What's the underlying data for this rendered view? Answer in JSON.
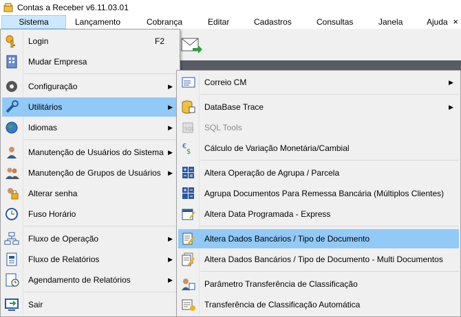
{
  "window": {
    "title": "Contas a Receber v6.11.03.01"
  },
  "menubar": {
    "items": [
      "Sistema",
      "Lançamento",
      "Cobrança",
      "Editar",
      "Cadastros",
      "Consultas",
      "Janela",
      "Ajuda"
    ],
    "close": "×"
  },
  "sistema_menu": {
    "items": [
      {
        "label": "Login",
        "shortcut": "F2",
        "icon": "key-icon"
      },
      {
        "label": "Mudar Empresa",
        "icon": "building-icon"
      },
      {
        "label": "Configuração",
        "icon": "gear-icon",
        "submenu": true
      },
      {
        "label": "Utilitários",
        "icon": "wrench-icon",
        "submenu": true,
        "highlighted": true
      },
      {
        "label": "Idiomas",
        "icon": "globe-icon",
        "submenu": true
      },
      {
        "label": "Manutenção de Usuários do Sistema",
        "icon": "user-icon",
        "submenu": true
      },
      {
        "label": "Manutenção de Grupos de Usuários",
        "icon": "users-icon",
        "submenu": true
      },
      {
        "label": "Alterar senha",
        "icon": "lock-user-icon"
      },
      {
        "label": "Fuso Horário",
        "icon": "clock-icon"
      },
      {
        "label": "Fluxo de Operação",
        "icon": "flowchart-icon",
        "submenu": true
      },
      {
        "label": "Fluxo de Relatórios",
        "icon": "report-flow-icon",
        "submenu": true
      },
      {
        "label": "Agendamento de Relatórios",
        "icon": "schedule-icon",
        "submenu": true
      },
      {
        "label": "Sair",
        "icon": "exit-icon"
      }
    ],
    "arrow": "▶"
  },
  "utilitarios_menu": {
    "items": [
      {
        "label": "Correio CM",
        "icon": "mail-icon",
        "submenu": true
      },
      {
        "label": "DataBase Trace",
        "icon": "database-icon",
        "submenu": true
      },
      {
        "label": "SQL Tools",
        "icon": "sql-icon",
        "disabled": true
      },
      {
        "label": "Cálculo de Variação Monetária/Cambial",
        "icon": "currency-icon"
      },
      {
        "label": "Altera Operação de Agrupa / Parcela",
        "icon": "calculator-icon"
      },
      {
        "label": "Agrupa Documentos Para Remessa Bancária (Múltiplos Clientes)",
        "icon": "calculator-plus-icon"
      },
      {
        "label": "Altera Data Programada - Express",
        "icon": "calendar-edit-icon"
      },
      {
        "label": "Altera Dados Bancários / Tipo de Documento",
        "icon": "doc-edit-icon",
        "highlighted": true
      },
      {
        "label": "Altera Dados Bancários / Tipo de Documento - Multi Documentos",
        "icon": "doc-multi-edit-icon"
      },
      {
        "label": "Parâmetro Transferência de Classificação",
        "icon": "transfer-param-icon"
      },
      {
        "label": "Transferência de Classificação Automática",
        "icon": "transfer-auto-icon"
      }
    ]
  },
  "colors": {
    "highlight": "#91c9f7",
    "menubar_active": "#cce8ff",
    "menu_bg": "#f0f0f0"
  }
}
